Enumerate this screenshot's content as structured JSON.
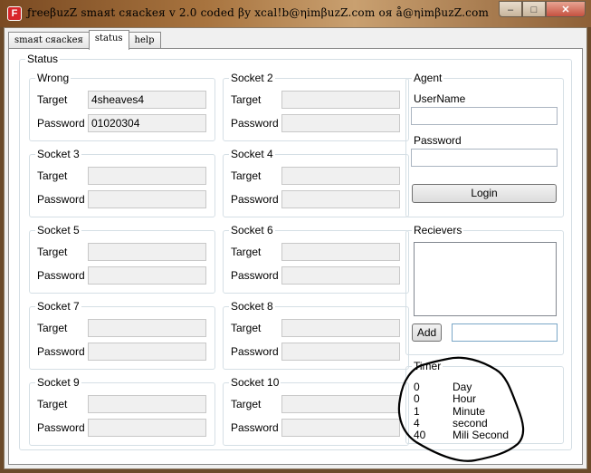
{
  "window": {
    "title": "ƒreeβuzZ smaяt cяackeя v 2.0 coded βy xcal!b@ηimβuzZ.com oя å@ηimβuzZ.com",
    "icon_letter": "F",
    "min_glyph": "–",
    "max_glyph": "□",
    "close_glyph": "✕"
  },
  "tabs": [
    {
      "label": "smaяt cяackeя",
      "active": false
    },
    {
      "label": "status",
      "active": true
    },
    {
      "label": "help",
      "active": false
    }
  ],
  "status_group": {
    "legend": "Status"
  },
  "sockets": [
    {
      "name": "Wrong",
      "target_label": "Target",
      "target_value": "4sheaves4",
      "password_label": "Password",
      "password_value": "01020304"
    },
    {
      "name": "Socket 2",
      "target_label": "Target",
      "target_value": "",
      "password_label": "Password",
      "password_value": ""
    },
    {
      "name": "Socket 3",
      "target_label": "Target",
      "target_value": "",
      "password_label": "Password",
      "password_value": ""
    },
    {
      "name": "Socket 4",
      "target_label": "Target",
      "target_value": "",
      "password_label": "Password",
      "password_value": ""
    },
    {
      "name": "Socket 5",
      "target_label": "Target",
      "target_value": "",
      "password_label": "Password",
      "password_value": ""
    },
    {
      "name": "Socket 6",
      "target_label": "Target",
      "target_value": "",
      "password_label": "Password",
      "password_value": ""
    },
    {
      "name": "Socket 7",
      "target_label": "Target",
      "target_value": "",
      "password_label": "Password",
      "password_value": ""
    },
    {
      "name": "Socket 8",
      "target_label": "Target",
      "target_value": "",
      "password_label": "Password",
      "password_value": ""
    },
    {
      "name": "Socket 9",
      "target_label": "Target",
      "target_value": "",
      "password_label": "Password",
      "password_value": ""
    },
    {
      "name": "Socket 10",
      "target_label": "Target",
      "target_value": "",
      "password_label": "Password",
      "password_value": ""
    }
  ],
  "agent": {
    "legend": "Agent",
    "username_label": "UserName",
    "password_label": "Password",
    "login_button": "Login"
  },
  "receivers": {
    "legend": "Recievers",
    "add_button": "Add"
  },
  "timer": {
    "legend": "Timer",
    "rows": [
      {
        "value": "0",
        "unit": "Day"
      },
      {
        "value": "0",
        "unit": "Hour"
      },
      {
        "value": "1",
        "unit": "Minute"
      },
      {
        "value": "4",
        "unit": "second"
      },
      {
        "value": "40",
        "unit": "Mili Second"
      }
    ]
  }
}
